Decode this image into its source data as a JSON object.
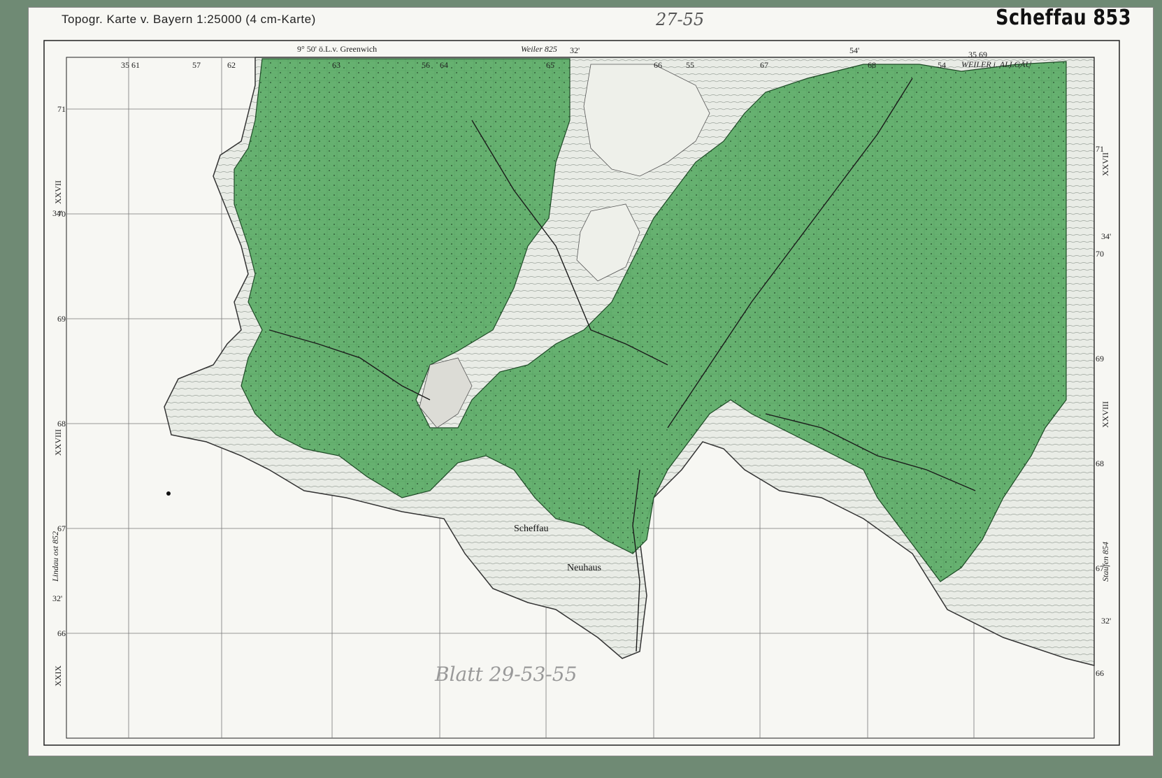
{
  "header": {
    "title": "Topogr. Karte v. Bayern 1:25000 (4 cm-Karte)",
    "sheet_name": "Scheffau 853"
  },
  "handwritten": {
    "top": "27-55",
    "bottom": "Blatt 29-53-55"
  },
  "frame_top": {
    "greenwich": "9° 50' ö.L.v. Greenwich",
    "neighbor_top": "Weiler 825",
    "neighbor_top_right": "WEILER i. ALLGÄU",
    "minutes": [
      "32'",
      "54'"
    ],
    "grid_numbers": [
      "35 61",
      "57",
      "62",
      "63",
      "56",
      "64",
      "65",
      "66",
      "55",
      "67",
      "68",
      "54",
      "35 69"
    ]
  },
  "frame_left": {
    "latitude_marks": [
      "34'",
      "32'"
    ],
    "roman": [
      "XXVII",
      "XXVIII",
      "XXIX"
    ],
    "grid_numbers": [
      "71",
      "70",
      "69",
      "68",
      "67",
      "66"
    ],
    "neighbor_left": "Lindau ost 852"
  },
  "frame_right": {
    "latitude_marks": [
      "34'",
      "32'"
    ],
    "roman": [
      "XXVII",
      "XXVIII"
    ],
    "grid_numbers": [
      "71",
      "70",
      "69",
      "68",
      "67",
      "66"
    ],
    "neighbor_right": "Staufen 854"
  },
  "places": {
    "town": "Scheffau",
    "town_sub": "Neuhaus"
  },
  "colors": {
    "forest": "#5fae6a",
    "forest_dark": "#2f6e3a",
    "paper": "#f7f7f3",
    "border": "#6f8a74"
  }
}
